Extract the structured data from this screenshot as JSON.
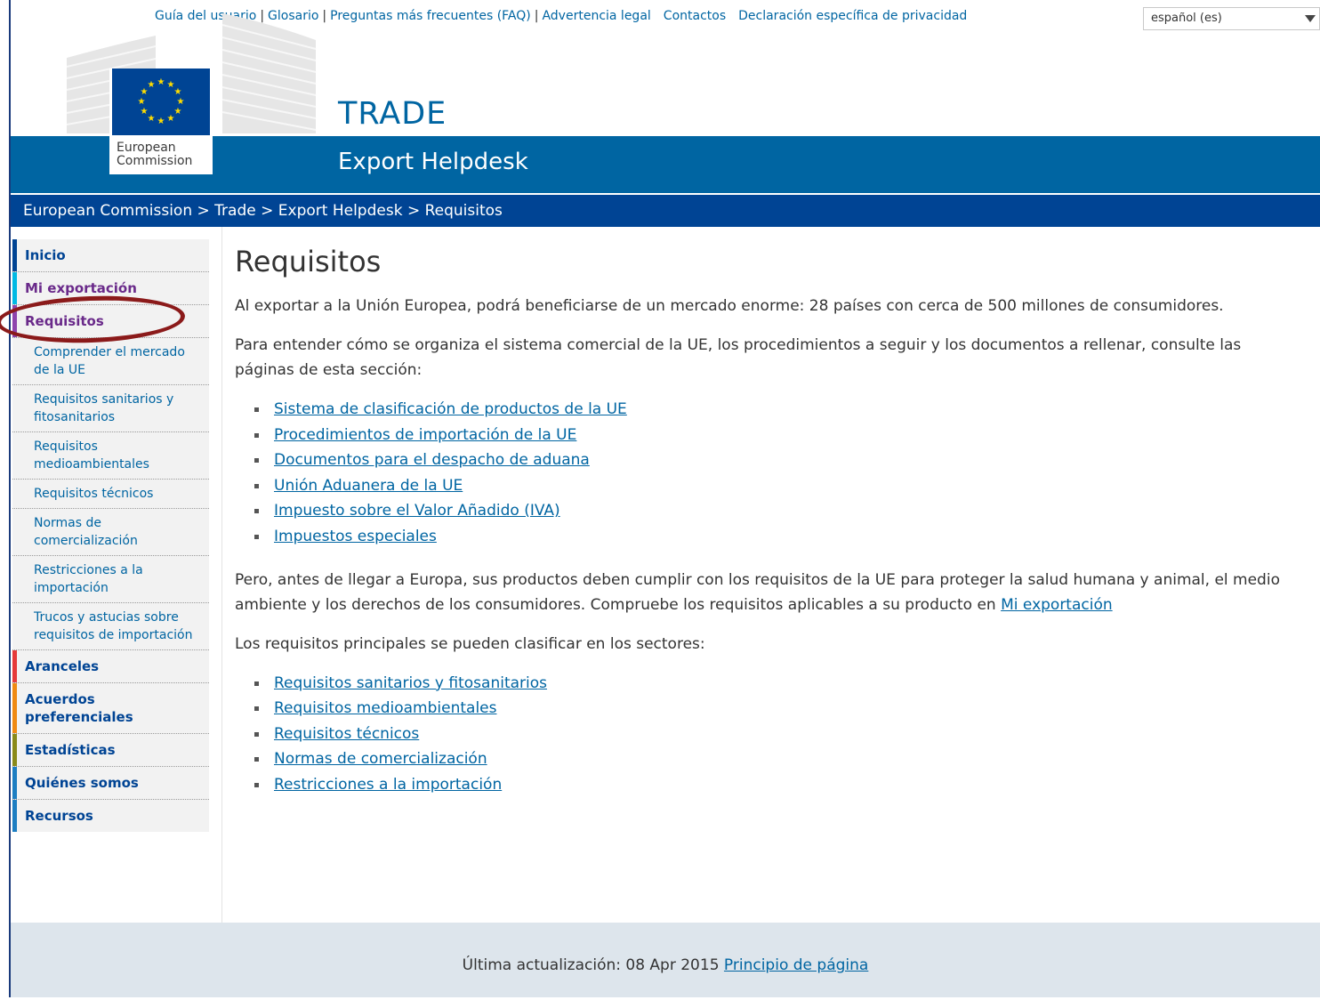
{
  "top_links": {
    "user_guide": "Guía del usuario",
    "glossary": "Glosario",
    "faq": "Preguntas más frecuentes (FAQ)",
    "legal": "Advertencia legal",
    "contacts": "Contactos",
    "privacy": "Declaración específica de privacidad",
    "separator": "|"
  },
  "language": {
    "selected": "español (es)"
  },
  "header": {
    "logo_line1": "European",
    "logo_line2": "Commission",
    "title": "TRADE",
    "subtitle": "Export Helpdesk"
  },
  "breadcrumb": {
    "items": [
      "European Commission",
      "Trade",
      "Export Helpdesk",
      "Requisitos"
    ],
    "separator": ">"
  },
  "sidebar": {
    "items": [
      {
        "label": "Inicio",
        "color": "#004494"
      },
      {
        "label": "Mi exportación",
        "color": "#00b9e4"
      },
      {
        "label": "Requisitos",
        "color": "#8e44ad"
      }
    ],
    "sub_items": [
      "Comprender el mercado de la UE",
      "Requisitos sanitarios y fitosanitarios",
      "Requisitos medioambientales",
      "Requisitos técnicos",
      "Normas de comercialización",
      "Restricciones a la importación",
      "Trucos y astucias sobre requisitos de importación"
    ],
    "more_items": [
      {
        "label": "Aranceles",
        "color": "#e63a3a"
      },
      {
        "label": "Acuerdos preferenciales",
        "color": "#f08a12"
      },
      {
        "label": "Estadísticas",
        "color": "#8a8a1a"
      },
      {
        "label": "Quiénes somos",
        "color": "#1d7ec2"
      },
      {
        "label": "Recursos",
        "color": "#1d7ec2"
      }
    ]
  },
  "main": {
    "title": "Requisitos",
    "intro": "Al exportar a la Unión Europea, podrá beneficiarse de un mercado enorme: 28 países con cerca de 500 millones de consumidores.",
    "para2": "Para entender cómo se organiza el sistema comercial de la UE, los procedimientos a seguir y los documentos a rellenar, consulte las páginas de esta sección:",
    "links1": [
      "Sistema de clasificación de productos de la UE",
      "Procedimientos de importación de la UE",
      "Documentos para el despacho de aduana",
      "Unión Aduanera de la UE",
      "Impuesto sobre el Valor Añadido (IVA)",
      "Impuestos especiales"
    ],
    "para3": "Pero, antes de llegar a Europa, sus productos deben cumplir con los requisitos de la UE para proteger la salud humana y animal, el medio ambiente y los derechos de los consumidores. Compruebe los requisitos aplicables a su producto en ",
    "para3_link": "Mi exportación",
    "para4": "Los requisitos principales se pueden clasificar en los sectores:",
    "links2": [
      "Requisitos sanitarios y fitosanitarios",
      "Requisitos medioambientales",
      "Requisitos técnicos",
      "Normas de comercialización",
      "Restricciones a la importación"
    ]
  },
  "footer": {
    "updated": "Última actualización: 08 Apr 2015",
    "top_link": "Principio de página"
  }
}
